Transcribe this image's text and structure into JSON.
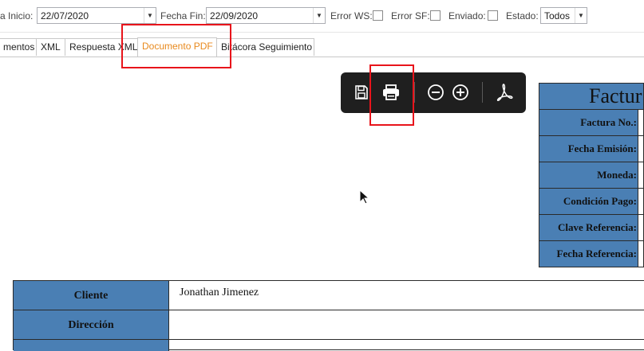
{
  "filters": {
    "fecha_inicio_label": "a Inicio:",
    "fecha_inicio_value": "22/07/2020",
    "fecha_fin_label": "Fecha Fin:",
    "fecha_fin_value": "22/09/2020",
    "error_ws_label": "Error WS:",
    "error_sf_label": "Error SF:",
    "enviado_label": "Enviado:",
    "estado_label": "Estado:",
    "estado_value": "Todos"
  },
  "tabs": [
    {
      "label": "mentos"
    },
    {
      "label": "XML"
    },
    {
      "label": "Respuesta XML"
    },
    {
      "label": "Documento PDF"
    },
    {
      "label": "Bitácora Seguimiento"
    }
  ],
  "active_tab": "Documento PDF",
  "pdf_toolbar": {
    "icons": [
      "save-icon",
      "print-icon",
      "zoom-out-icon",
      "zoom-in-icon",
      "acrobat-icon"
    ]
  },
  "invoice": {
    "title": "Factur",
    "fields": [
      {
        "label": "Factura No.:"
      },
      {
        "label": "Fecha Emisión:"
      },
      {
        "label": "Moneda:"
      },
      {
        "label": "Condición Pago:"
      },
      {
        "label": "Clave Referencia:"
      },
      {
        "label": "Fecha Referencia:"
      }
    ]
  },
  "cliente": {
    "rows": [
      {
        "label": "Cliente",
        "value": "Jonathan Jimenez"
      },
      {
        "label": "Dirección",
        "value": ""
      }
    ]
  },
  "colors": {
    "header_blue": "#4a7fb4",
    "active_tab": "#e8891d",
    "annotation_red": "#e8141b",
    "toolbar_bg": "#1f1f1f"
  }
}
